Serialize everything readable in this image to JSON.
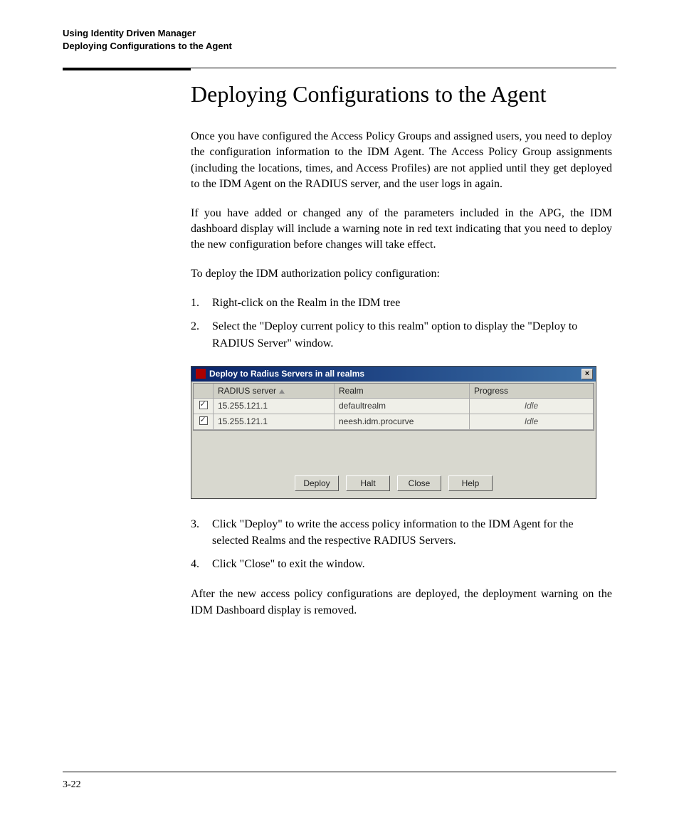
{
  "header": {
    "line1": "Using Identity Driven Manager",
    "line2": "Deploying Configurations to the Agent"
  },
  "title": "Deploying Configurations to the Agent",
  "paragraphs": {
    "p1": "Once you have configured the Access Policy Groups and assigned users, you need to deploy the configuration information to the IDM Agent. The Access Policy Group assignments (including the locations, times, and Access Profiles) are not applied until they get deployed to the IDM Agent on the RADIUS server, and the user logs in again.",
    "p2": "If you have added or changed any of the parameters included in the APG, the IDM dashboard display will include a warning note in red text indicating that you need to deploy the new configuration before changes will take effect.",
    "p3": "To deploy the IDM authorization policy configuration:",
    "p4": "After the new access policy configurations are deployed, the deployment warning on the IDM Dashboard display is removed."
  },
  "steps": {
    "s1": "Right-click on the Realm in the IDM tree",
    "s2": "Select the \"Deploy current policy to this realm\" option to display the \"Deploy to RADIUS Server\" window.",
    "s3": "Click \"Deploy\" to write the access policy information to the IDM Agent for the selected Realms and the respective RADIUS Servers.",
    "s4": "Click \"Close\" to exit the window."
  },
  "dialog": {
    "title": "Deploy to Radius Servers in all realms",
    "columns": {
      "c1": "RADIUS server",
      "c2": "Realm",
      "c3": "Progress"
    },
    "rows": [
      {
        "server": "15.255.121.1",
        "realm": "defaultrealm",
        "progress": "Idle"
      },
      {
        "server": "15.255.121.1",
        "realm": "neesh.idm.procurve",
        "progress": "Idle"
      }
    ],
    "buttons": {
      "deploy": "Deploy",
      "halt": "Halt",
      "close": "Close",
      "help": "Help"
    },
    "close_x": "×"
  },
  "nums": {
    "n1": "1.",
    "n2": "2.",
    "n3": "3.",
    "n4": "4."
  },
  "page_number": "3-22"
}
